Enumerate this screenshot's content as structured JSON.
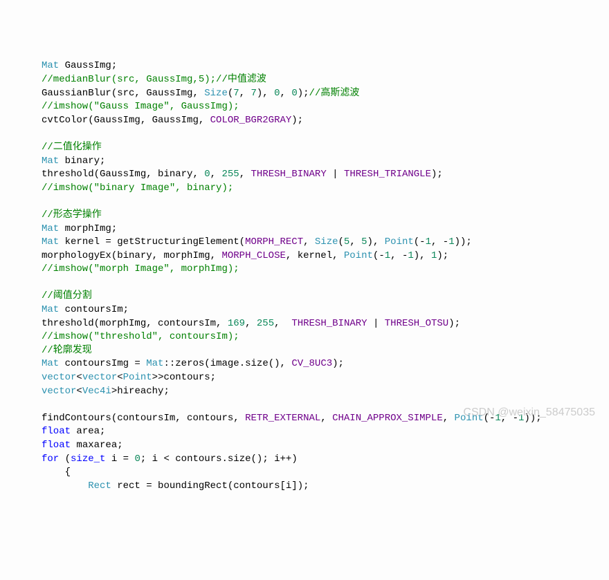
{
  "lines": [
    [
      {
        "t": "Mat",
        "c": "type"
      },
      {
        "t": " GaussImg;",
        "c": "punct"
      }
    ],
    [
      {
        "t": "//medianBlur(src, GaussImg,5);//中值滤波",
        "c": "comment"
      }
    ],
    [
      {
        "t": "GaussianBlur",
        "c": "func"
      },
      {
        "t": "(src, GaussImg, ",
        "c": "punct"
      },
      {
        "t": "Size",
        "c": "type"
      },
      {
        "t": "(",
        "c": "punct"
      },
      {
        "t": "7",
        "c": "number"
      },
      {
        "t": ", ",
        "c": "punct"
      },
      {
        "t": "7",
        "c": "number"
      },
      {
        "t": "), ",
        "c": "punct"
      },
      {
        "t": "0",
        "c": "number"
      },
      {
        "t": ", ",
        "c": "punct"
      },
      {
        "t": "0",
        "c": "number"
      },
      {
        "t": ");",
        "c": "punct"
      },
      {
        "t": "//高斯滤波",
        "c": "comment"
      }
    ],
    [
      {
        "t": "//imshow(\"Gauss Image\", GaussImg);",
        "c": "comment"
      }
    ],
    [
      {
        "t": "cvtColor",
        "c": "func"
      },
      {
        "t": "(GaussImg, GaussImg, ",
        "c": "punct"
      },
      {
        "t": "COLOR_BGR2GRAY",
        "c": "const"
      },
      {
        "t": ");",
        "c": "punct"
      }
    ],
    [
      {
        "t": "",
        "c": "punct"
      }
    ],
    [
      {
        "t": "//二值化操作",
        "c": "comment"
      }
    ],
    [
      {
        "t": "Mat",
        "c": "type"
      },
      {
        "t": " binary;",
        "c": "punct"
      }
    ],
    [
      {
        "t": "threshold",
        "c": "func"
      },
      {
        "t": "(GaussImg, binary, ",
        "c": "punct"
      },
      {
        "t": "0",
        "c": "number"
      },
      {
        "t": ", ",
        "c": "punct"
      },
      {
        "t": "255",
        "c": "number"
      },
      {
        "t": ", ",
        "c": "punct"
      },
      {
        "t": "THRESH_BINARY",
        "c": "const"
      },
      {
        "t": " | ",
        "c": "punct"
      },
      {
        "t": "THRESH_TRIANGLE",
        "c": "const"
      },
      {
        "t": ");",
        "c": "punct"
      }
    ],
    [
      {
        "t": "//imshow(\"binary Image\", binary);",
        "c": "comment"
      }
    ],
    [
      {
        "t": "",
        "c": "punct"
      }
    ],
    [
      {
        "t": "//形态学操作",
        "c": "comment"
      }
    ],
    [
      {
        "t": "Mat",
        "c": "type"
      },
      {
        "t": " morphImg;",
        "c": "punct"
      }
    ],
    [
      {
        "t": "Mat",
        "c": "type"
      },
      {
        "t": " kernel = ",
        "c": "punct"
      },
      {
        "t": "getStructuringElement",
        "c": "func"
      },
      {
        "t": "(",
        "c": "punct"
      },
      {
        "t": "MORPH_RECT",
        "c": "const"
      },
      {
        "t": ", ",
        "c": "punct"
      },
      {
        "t": "Size",
        "c": "type"
      },
      {
        "t": "(",
        "c": "punct"
      },
      {
        "t": "5",
        "c": "number"
      },
      {
        "t": ", ",
        "c": "punct"
      },
      {
        "t": "5",
        "c": "number"
      },
      {
        "t": "), ",
        "c": "punct"
      },
      {
        "t": "Point",
        "c": "type"
      },
      {
        "t": "(-",
        "c": "punct"
      },
      {
        "t": "1",
        "c": "number"
      },
      {
        "t": ", -",
        "c": "punct"
      },
      {
        "t": "1",
        "c": "number"
      },
      {
        "t": "));",
        "c": "punct"
      }
    ],
    [
      {
        "t": "morphologyEx",
        "c": "func"
      },
      {
        "t": "(binary, morphImg, ",
        "c": "punct"
      },
      {
        "t": "MORPH_CLOSE",
        "c": "const"
      },
      {
        "t": ", kernel, ",
        "c": "punct"
      },
      {
        "t": "Point",
        "c": "type"
      },
      {
        "t": "(-",
        "c": "punct"
      },
      {
        "t": "1",
        "c": "number"
      },
      {
        "t": ", -",
        "c": "punct"
      },
      {
        "t": "1",
        "c": "number"
      },
      {
        "t": "), ",
        "c": "punct"
      },
      {
        "t": "1",
        "c": "number"
      },
      {
        "t": ");",
        "c": "punct"
      }
    ],
    [
      {
        "t": "//imshow(\"morph Image\", morphImg);",
        "c": "comment"
      }
    ],
    [
      {
        "t": "",
        "c": "punct"
      }
    ],
    [
      {
        "t": "//阈值分割",
        "c": "comment"
      }
    ],
    [
      {
        "t": "Mat",
        "c": "type"
      },
      {
        "t": " contoursIm;",
        "c": "punct"
      }
    ],
    [
      {
        "t": "threshold",
        "c": "func"
      },
      {
        "t": "(morphImg, contoursIm, ",
        "c": "punct"
      },
      {
        "t": "169",
        "c": "number"
      },
      {
        "t": ", ",
        "c": "punct"
      },
      {
        "t": "255",
        "c": "number"
      },
      {
        "t": ",  ",
        "c": "punct"
      },
      {
        "t": "THRESH_BINARY",
        "c": "const"
      },
      {
        "t": " | ",
        "c": "punct"
      },
      {
        "t": "THRESH_OTSU",
        "c": "const"
      },
      {
        "t": ");",
        "c": "punct"
      }
    ],
    [
      {
        "t": "//imshow(\"threshold\", contoursIm);",
        "c": "comment"
      }
    ],
    [
      {
        "t": "//轮廓发现",
        "c": "comment"
      }
    ],
    [
      {
        "t": "Mat",
        "c": "type"
      },
      {
        "t": " contoursImg = ",
        "c": "punct"
      },
      {
        "t": "Mat",
        "c": "type"
      },
      {
        "t": "::",
        "c": "punct"
      },
      {
        "t": "zeros",
        "c": "func"
      },
      {
        "t": "(image.",
        "c": "punct"
      },
      {
        "t": "size",
        "c": "func"
      },
      {
        "t": "(), ",
        "c": "punct"
      },
      {
        "t": "CV_8UC3",
        "c": "const"
      },
      {
        "t": ");",
        "c": "punct"
      }
    ],
    [
      {
        "t": "vector",
        "c": "type"
      },
      {
        "t": "<",
        "c": "punct"
      },
      {
        "t": "vector",
        "c": "type"
      },
      {
        "t": "<",
        "c": "punct"
      },
      {
        "t": "Point",
        "c": "type"
      },
      {
        "t": ">>contours;",
        "c": "punct"
      }
    ],
    [
      {
        "t": "vector",
        "c": "type"
      },
      {
        "t": "<",
        "c": "punct"
      },
      {
        "t": "Vec4i",
        "c": "type"
      },
      {
        "t": ">hireachy;",
        "c": "punct"
      }
    ],
    [
      {
        "t": "",
        "c": "punct"
      }
    ],
    [
      {
        "t": "findContours",
        "c": "func"
      },
      {
        "t": "(contoursIm, contours, ",
        "c": "punct"
      },
      {
        "t": "RETR_EXTERNAL",
        "c": "const"
      },
      {
        "t": ", ",
        "c": "punct"
      },
      {
        "t": "CHAIN_APPROX_SIMPLE",
        "c": "const"
      },
      {
        "t": ", ",
        "c": "punct"
      },
      {
        "t": "Point",
        "c": "type"
      },
      {
        "t": "(-",
        "c": "punct"
      },
      {
        "t": "1",
        "c": "number"
      },
      {
        "t": ", -",
        "c": "punct"
      },
      {
        "t": "1",
        "c": "number"
      },
      {
        "t": "));",
        "c": "punct"
      }
    ],
    [
      {
        "t": "float",
        "c": "kw"
      },
      {
        "t": " area;",
        "c": "punct"
      }
    ],
    [
      {
        "t": "float",
        "c": "kw"
      },
      {
        "t": " maxarea;",
        "c": "punct"
      }
    ],
    [
      {
        "t": "for",
        "c": "kw"
      },
      {
        "t": " (",
        "c": "punct"
      },
      {
        "t": "size_t",
        "c": "kw"
      },
      {
        "t": " i = ",
        "c": "punct"
      },
      {
        "t": "0",
        "c": "number"
      },
      {
        "t": "; i < contours.",
        "c": "punct"
      },
      {
        "t": "size",
        "c": "func"
      },
      {
        "t": "(); i++)",
        "c": "punct"
      }
    ],
    [
      {
        "t": "    {",
        "c": "punct"
      }
    ],
    [
      {
        "t": "        ",
        "c": "punct"
      },
      {
        "t": "Rect",
        "c": "type"
      },
      {
        "t": " rect = ",
        "c": "punct"
      },
      {
        "t": "boundingRect",
        "c": "func"
      },
      {
        "t": "(contours[i]);",
        "c": "punct"
      }
    ]
  ],
  "watermark": "CSDN @weixin_58475035"
}
